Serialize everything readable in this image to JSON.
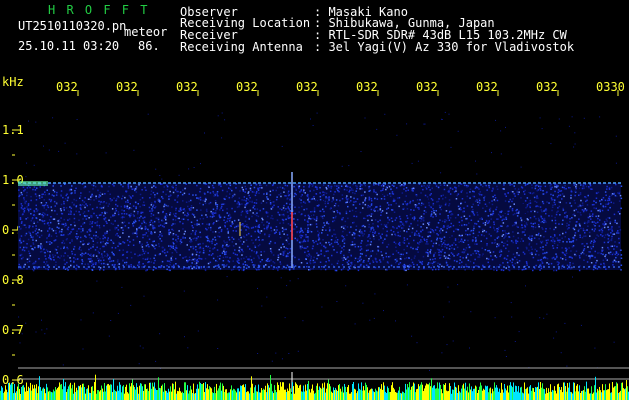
{
  "header": {
    "app_name": "H R O F F T",
    "filename": "UT2510110320.pn",
    "mode": "meteor",
    "datetime": "25.10.11 03:20",
    "value": "86."
  },
  "info": {
    "labels": [
      "Observer",
      "Receiving Location",
      "Receiver",
      "Receiving Antenna"
    ],
    "values": [
      ": Masaki Kano",
      ": Shibukawa, Gunma, Japan",
      ": RTL-SDR SDR# 43dB L15 103.2MHz CW",
      ": 3el Yagi(V) Az 330 for Vladivostok"
    ]
  },
  "axis": {
    "unit": "kHz",
    "time_labels": [
      "032",
      "032",
      "032",
      "032",
      "032",
      "032",
      "032",
      "032",
      "032",
      "0330"
    ],
    "freq_labels": [
      "1.1",
      "1.0",
      "0.9",
      "0.8",
      "0.7",
      "0.6"
    ]
  },
  "colors": {
    "background": "#000000",
    "title_green": "#22cc44",
    "text_white": "#ffffff",
    "tick_yellow": "#ffff33",
    "noise_blue": "#1a2fd0",
    "meteor_signal": "#ff3333"
  }
}
